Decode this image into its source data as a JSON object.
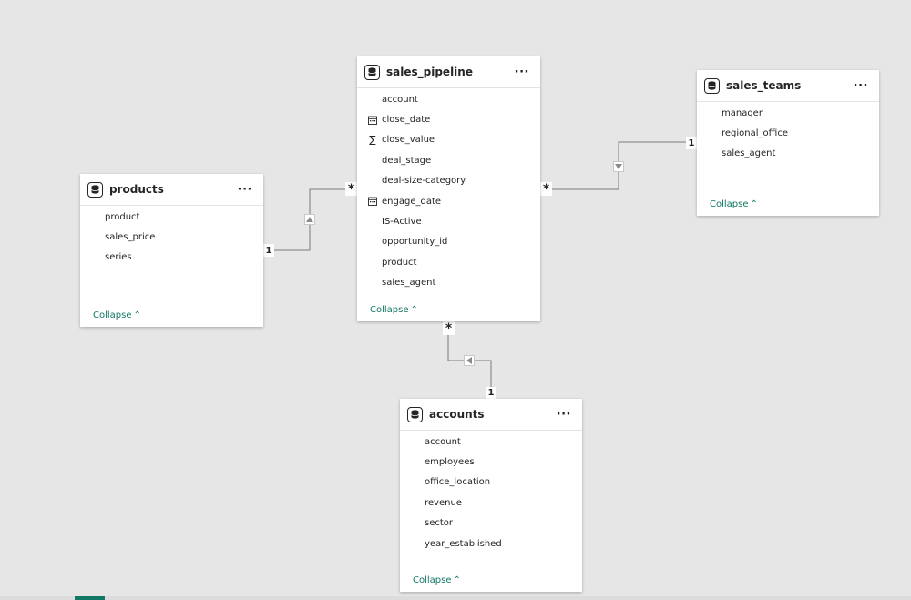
{
  "tables": {
    "products": {
      "title": "products",
      "fields": [
        "product",
        "sales_price",
        "series"
      ],
      "collapse_label": "Collapse"
    },
    "sales_pipeline": {
      "title": "sales_pipeline",
      "fields": [
        "account",
        "close_date",
        "close_value",
        "deal_stage",
        "deal-size-category",
        "engage_date",
        "IS-Active",
        "opportunity_id",
        "product",
        "sales_agent"
      ],
      "collapse_label": "Collapse"
    },
    "sales_teams": {
      "title": "sales_teams",
      "fields": [
        "manager",
        "regional_office",
        "sales_agent"
      ],
      "collapse_label": "Collapse"
    },
    "accounts": {
      "title": "accounts",
      "fields": [
        "account",
        "employees",
        "office_location",
        "revenue",
        "sector",
        "year_established"
      ],
      "collapse_label": "Collapse"
    }
  },
  "relationships": {
    "products_to_pipeline": {
      "one": "1",
      "many": "*"
    },
    "teams_to_pipeline": {
      "one": "1",
      "many": "*"
    },
    "accounts_to_pipeline": {
      "one": "1",
      "many": "*"
    }
  },
  "field_icons": {
    "close_date": "calendar-icon",
    "close_value": "sigma-icon",
    "engage_date": "calendar-icon"
  },
  "colors": {
    "canvas": "#e6e6e6",
    "accent": "#117865",
    "line": "#7a7a7a"
  }
}
